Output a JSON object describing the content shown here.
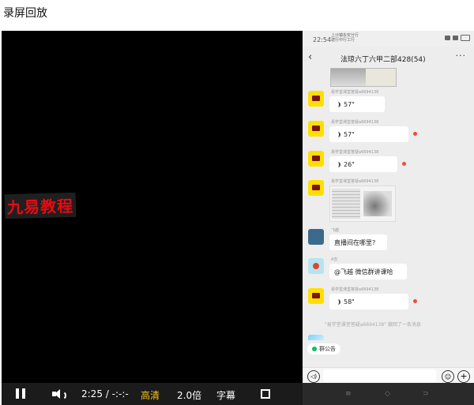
{
  "page": {
    "title": "录屏回放"
  },
  "watermark": "九易教程",
  "phone": {
    "status": {
      "time": "22:54",
      "mid_line1": "上沙镇永安分行",
      "mid_line2": "建行中行工行"
    },
    "header": {
      "back": "‹",
      "title": "法琼六丁六甲二部428(54)",
      "more": "···"
    },
    "messages": [
      {
        "type": "voice",
        "sender": "易学堂课堂答疑a6694138",
        "duration": "57\"",
        "unread": false
      },
      {
        "type": "voice",
        "sender": "易学堂课堂答疑a6694138",
        "duration": "57\"",
        "unread": true
      },
      {
        "type": "voice",
        "sender": "易学堂课堂答疑a6694138",
        "duration": "26\"",
        "unread": true
      },
      {
        "type": "image",
        "sender": "易学堂课堂答疑a6694138"
      },
      {
        "type": "text",
        "sender": "飞越",
        "text": "直播间在哪里?"
      },
      {
        "type": "text",
        "sender": "A吉",
        "text": "@飞越  微信群讲课哈"
      },
      {
        "type": "voice",
        "sender": "易学堂课堂答疑a6694138",
        "duration": "58\"",
        "unread": true
      }
    ],
    "system_note": "\"易学堂课堂答疑a6694138\" 撤回了一条消息",
    "notice": "群公告",
    "input": {
      "voice": "◁)",
      "emoji": "☺",
      "plus": "+"
    }
  },
  "player": {
    "time": "2:25  /  -:-:-",
    "quality": "高清",
    "speed": "2.0倍",
    "subtitle": "字幕"
  },
  "colors": {
    "quality": "#f5c518",
    "unread_dot": "#f24a3e",
    "watermark": "#e60b12"
  }
}
